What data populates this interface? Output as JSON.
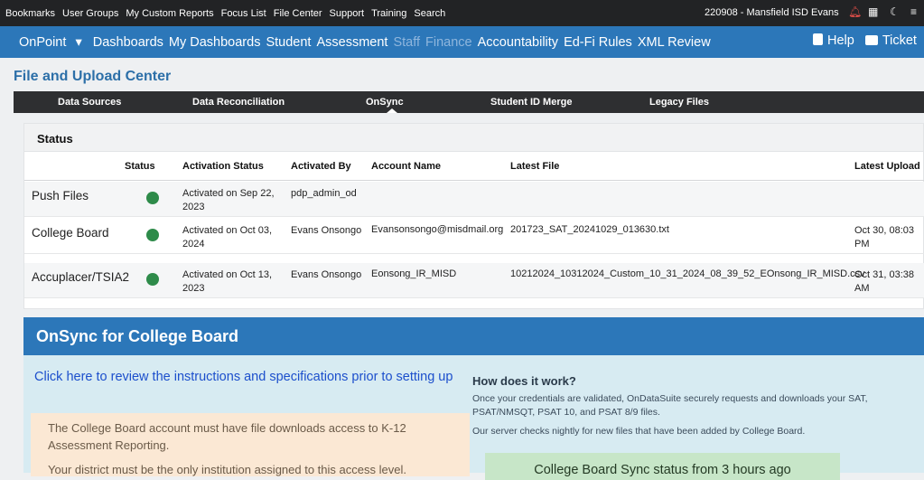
{
  "topbar": {
    "links": [
      "Bookmarks",
      "User Groups",
      "My Custom Reports",
      "Focus List",
      "File Center",
      "Support",
      "Training",
      "Search"
    ],
    "user": "220908 - Mansfield ISD Evans",
    "icons": [
      "bell-icon",
      "calendar-icon",
      "moon-icon",
      "menu-icon"
    ]
  },
  "nav": {
    "brand": "OnPoint",
    "items": [
      "Dashboards",
      "My Dashboards",
      "Student",
      "Assessment"
    ],
    "dimmed": [
      "Staff",
      "Finance"
    ],
    "items2": [
      "Accountability",
      "Ed-Fi Rules",
      "XML Review"
    ],
    "help": "Help",
    "ticket": "Ticket",
    "colors": {
      "bar": "#2c77b9",
      "dimmed_text": "#8fb6dd"
    }
  },
  "page": {
    "title": "File and Upload Center"
  },
  "tabs": [
    "Data Sources",
    "Data Reconciliation",
    "OnSync",
    "Student ID Merge",
    "Legacy Files"
  ],
  "tabs_active": "OnSync",
  "status": {
    "title": "Status",
    "columns": [
      "Status",
      "Activation Status",
      "Activated By",
      "Account Name",
      "Latest File",
      "Latest Upload"
    ],
    "rows": [
      {
        "name": "Push Files",
        "activation": "Activated on Sep 22, 2023",
        "by": "pdp_admin_od",
        "account": "",
        "file": "",
        "upload": ""
      },
      {
        "name": "College Board",
        "activation": "Activated on Oct 03, 2024",
        "by": "Evans Onsongo",
        "account": "Evansonsongo@misdmail.org",
        "file": "201723_SAT_20241029_013630.txt",
        "upload": "Oct 30, 08:03 PM"
      },
      {
        "name": "Accuplacer/TSIA2",
        "activation": "Activated on Oct 13, 2023",
        "by": "Evans Onsongo",
        "account": "Eonsong_IR_MISD",
        "file": "10212024_10312024_Custom_10_31_2024_08_39_52_EOnsong_IR_MISD.csv",
        "upload": "Oct 31, 03:38 AM"
      }
    ],
    "status_color": "#2e8b4a"
  },
  "college_board": {
    "title": "OnSync for College Board",
    "link": "Click here to review the instructions and specifications prior to setting up",
    "notes": [
      "The College Board account must have file downloads access to K-12 Assessment Reporting.",
      "Your district must be the only institution assigned to this access level."
    ],
    "how_title": "How does it work?",
    "how_text": [
      "Once your credentials are validated, OnDataSuite securely requests and downloads your SAT, PSAT/NMSQT, PSAT 10, and PSAT 8/9 files.",
      "Our server checks nightly for new files that have been added by College Board."
    ],
    "sync_status": "College Board Sync status from 3 hours ago"
  }
}
